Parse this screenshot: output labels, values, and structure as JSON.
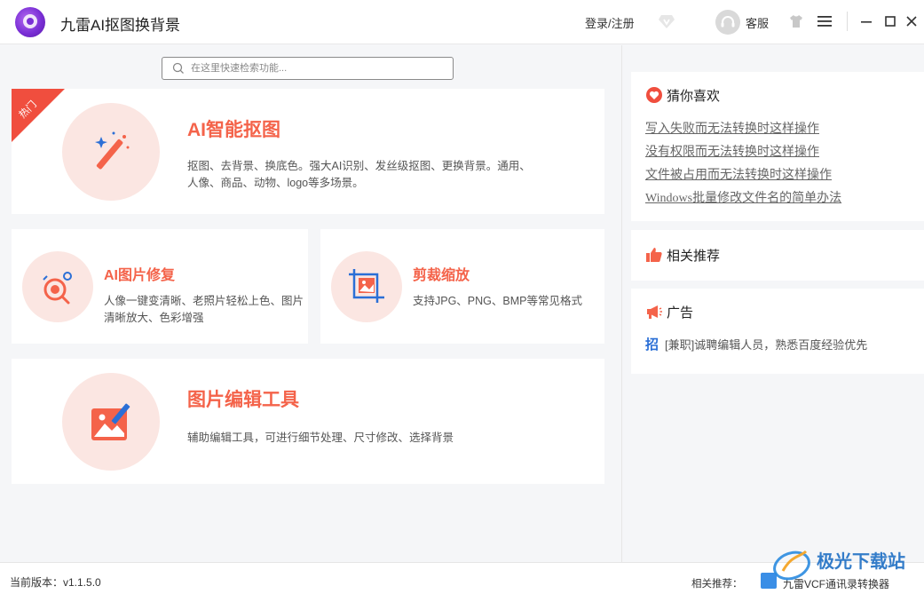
{
  "titlebar": {
    "app_title": "九雷AI抠图换背景",
    "login_label": "登录/注册",
    "service_label": "客服",
    "icons": [
      "app-logo-icon",
      "vip-diamond-icon",
      "headset-icon",
      "tshirt-skin-icon",
      "menu-icon",
      "minimize-icon",
      "maximize-icon",
      "close-icon"
    ]
  },
  "search": {
    "placeholder": "在这里快速检索功能..."
  },
  "features": {
    "cutout": {
      "badge": "热门",
      "title": "AI智能抠图",
      "desc": "抠图、去背景、换底色。强大AI识别、发丝级抠图、更换背景。通用、人像、商品、动物、logo等多场景。"
    },
    "repair": {
      "title": "AI图片修复",
      "desc": "人像一键变清晰、老照片轻松上色、图片清晰放大、色彩增强"
    },
    "crop": {
      "title": "剪裁缩放",
      "desc": "支持JPG、PNG、BMP等常见格式"
    },
    "edit": {
      "title": "图片编辑工具",
      "desc": "辅助编辑工具，可进行细节处理、尺寸修改、选择背景"
    }
  },
  "sidebar": {
    "like": {
      "title": "猜你喜欢",
      "links": [
        "写入失败而无法转换时这样操作",
        "没有权限而无法转换时这样操作",
        "文件被占用而无法转换时这样操作",
        "Windows批量修改文件名的简单办法"
      ]
    },
    "recommend": {
      "title": "相关推荐"
    },
    "ad": {
      "title": "广告",
      "icon_char": "招",
      "text": "[兼职]诚聘编辑人员，熟悉百度经验优先"
    }
  },
  "statusbar": {
    "version": "当前版本：v1.1.5.0",
    "related_label": "相关推荐：",
    "related_app": "九雷VCF通讯录转换器"
  },
  "watermark": {
    "text": "极光下载站"
  },
  "colors": {
    "accent": "#f4634a",
    "ribbon": "#f04e3e",
    "circle_bg": "#fbe6e2",
    "icon_blue": "#2b6fd6"
  }
}
